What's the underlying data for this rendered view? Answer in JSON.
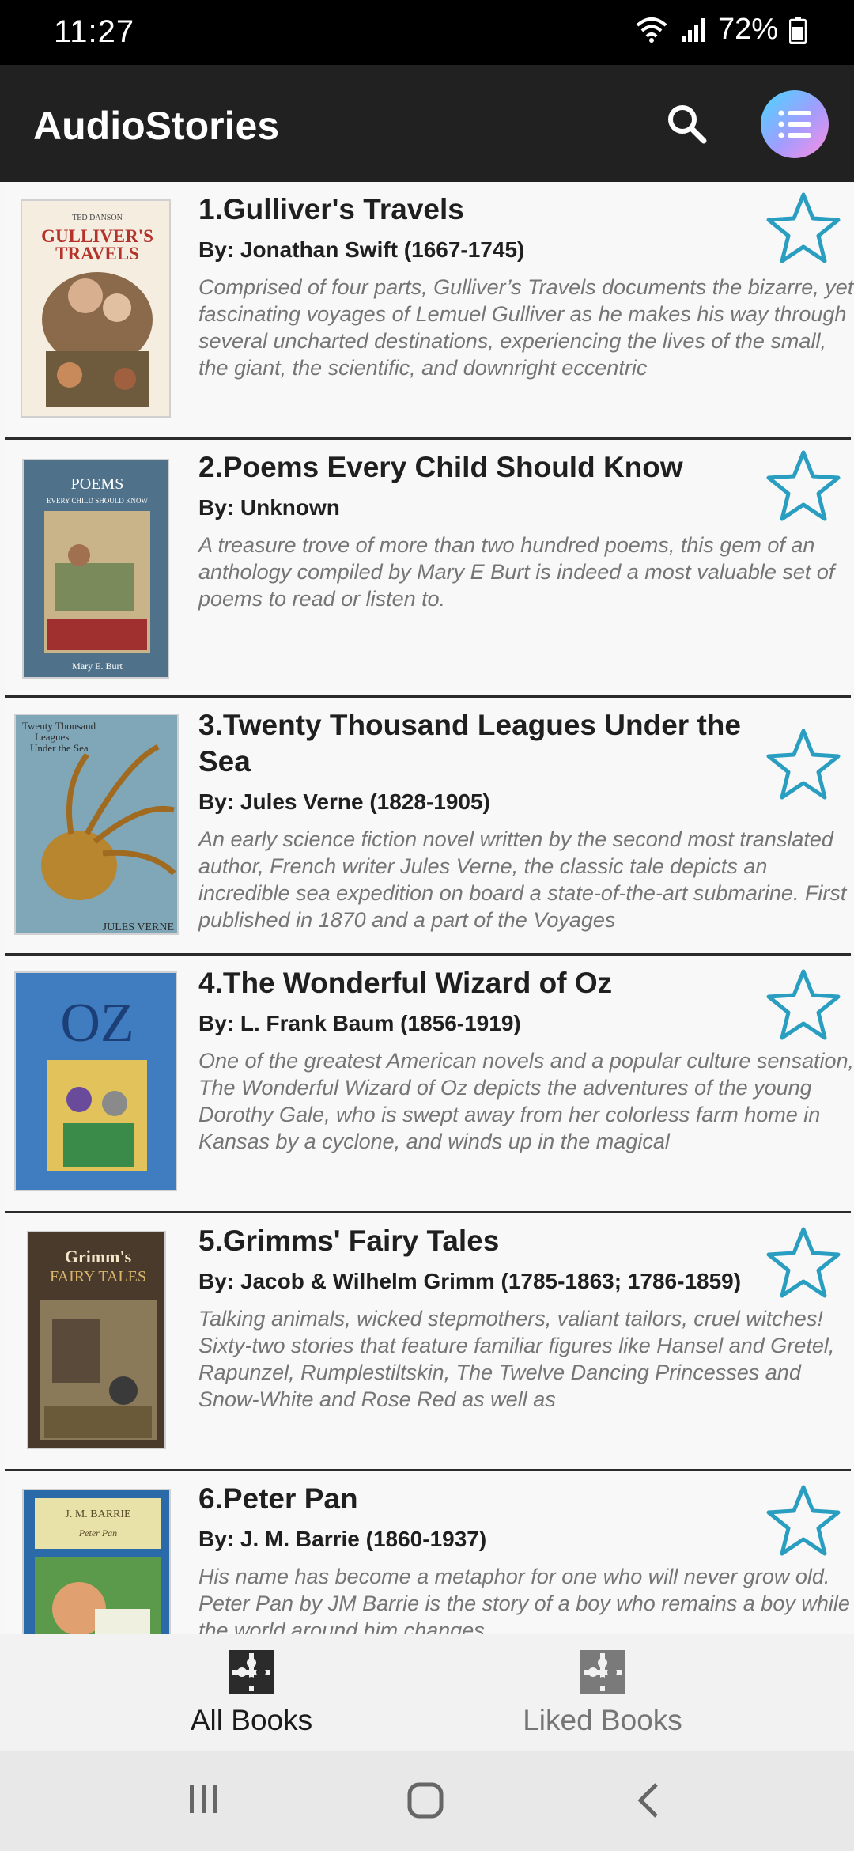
{
  "status_bar": {
    "time": "11:27",
    "battery": "72%"
  },
  "app_bar": {
    "title": "AudioStories"
  },
  "books": [
    {
      "title": "1.Gulliver's Travels",
      "author": "By: Jonathan Swift (1667-1745)",
      "description": "Comprised of four parts, Gulliver’s Travels documents the bizarre, yet fascinating voyages of Lemuel Gulliver as he makes his way through several uncharted destinations, experiencing the lives of the small, the giant, the scientific, and downright eccentric",
      "cover_text": "GULLIVER'S TRAVELS",
      "cover_subtext": "TED DANSON",
      "cover_colors": [
        "#f4ede0",
        "#b5322a"
      ]
    },
    {
      "title": "2.Poems Every Child Should Know",
      "author": "By: Unknown",
      "description": "A treasure trove of more than two hundred poems, this gem of an anthology compiled by Mary E Burt is indeed a most valuable set of poems to read or listen to.",
      "cover_text": "POEMS",
      "cover_subtext": "EVERY CHILD SHOULD KNOW",
      "cover_footer": "Mary E. Burt",
      "cover_colors": [
        "#4f7189",
        "#c9b48a"
      ]
    },
    {
      "title": "3.Twenty Thousand Leagues Under the Sea",
      "author": "By: Jules Verne (1828-1905)",
      "description": "An early science fiction novel written by the second most translated author, French writer Jules Verne, the classic tale depicts an incredible sea expedition on board a state-of-the-art submarine. First published in 1870 and a part of the Voyages",
      "cover_text": "Twenty Thousand Leagues Under the Sea",
      "cover_footer": "JULES VERNE",
      "cover_colors": [
        "#7fa7b8",
        "#b7862f"
      ]
    },
    {
      "title": "4.The Wonderful Wizard of Oz",
      "author": "By: L. Frank Baum (1856-1919)",
      "description": "One of the greatest American novels and a popular culture sensation, The Wonderful Wizard of Oz depicts the adventures of the young Dorothy Gale, who is swept away from her colorless farm home in Kansas by a cyclone, and winds up in the magical",
      "cover_text": "OZ",
      "cover_colors": [
        "#3f7cc0",
        "#e2c25a"
      ]
    },
    {
      "title": "5.Grimms' Fairy Tales",
      "author": "By: Jacob & Wilhelm Grimm (1785-1863; 1786-1859)",
      "description": "Talking animals, wicked stepmothers, valiant tailors, cruel witches! Sixty-two stories that feature familiar figures like Hansel and Gretel, Rapunzel, Rumplestiltskin, The Twelve Dancing Princesses and Snow-White and Rose Red as well as",
      "cover_text": "Grimm's FAIRY TALES",
      "cover_colors": [
        "#4a3a2c",
        "#d9b56a"
      ]
    },
    {
      "title": "6.Peter Pan",
      "author": "By: J. M. Barrie (1860-1937)",
      "description": "His name has become a metaphor for one who will never grow old. Peter Pan by JM Barrie is the story of a boy who remains a boy while the world around him changes.",
      "cover_text": "J. M. BARRIE",
      "cover_subtext": "Peter Pan",
      "cover_colors": [
        "#2a6aa8",
        "#e9e2a8"
      ]
    }
  ],
  "bottom_nav": {
    "all_books": "All Books",
    "liked_books": "Liked Books"
  },
  "colors": {
    "accent_star": "#2a9ec0",
    "app_bar": "#212121",
    "divider": "#2b2b2b"
  }
}
